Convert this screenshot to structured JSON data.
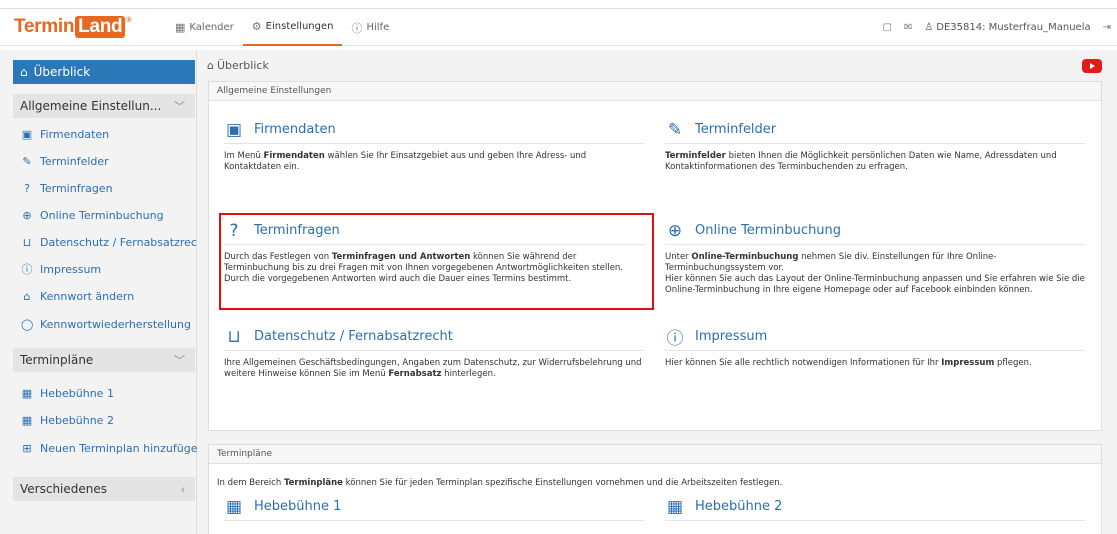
{
  "topbar": {
    "logo_a": "Termin",
    "logo_b": "Land",
    "logo_mark": "®",
    "nav": [
      {
        "label": "Kalender",
        "icon": "calendar-icon"
      },
      {
        "label": "Einstellungen",
        "icon": "gear-icon"
      },
      {
        "label": "Hilfe",
        "icon": "help-icon"
      }
    ],
    "user": "DE35814: Musterfrau_Manuela"
  },
  "sidebar": {
    "overview": "Überblick",
    "group1": "Allgemeine Einstellun...",
    "group1_items": [
      {
        "label": "Firmendaten",
        "icon": "id-card-icon"
      },
      {
        "label": "Terminfelder",
        "icon": "edit-icon"
      },
      {
        "label": "Terminfragen",
        "icon": "question-icon"
      },
      {
        "label": "Online Terminbuchung",
        "icon": "globe-icon"
      },
      {
        "label": "Datenschutz / Fernabsatzrecht",
        "icon": "cart-icon"
      },
      {
        "label": "Impressum",
        "icon": "info-icon"
      },
      {
        "label": "Kennwort ändern",
        "icon": "lock-icon"
      },
      {
        "label": "Kennwortwiederherstellung",
        "icon": "shield-icon"
      }
    ],
    "group2": "Terminpläne",
    "group2_items": [
      {
        "label": "Hebebühne 1",
        "icon": "calendar-grid-icon"
      },
      {
        "label": "Hebebühne 2",
        "icon": "calendar-grid-icon"
      },
      {
        "label": "Neuen Terminplan hinzufügen",
        "icon": "calendar-add-icon"
      }
    ],
    "group3": "Verschiedenes"
  },
  "main": {
    "breadcrumb": "Überblick",
    "panel1_title": "Allgemeine Einstellungen",
    "tiles": {
      "firmendaten": {
        "title": "Firmendaten",
        "d1": "Im Menü ",
        "b1": "Firmendaten",
        "d2": " wählen Sie Ihr Einsatzgebiet aus und geben Ihre Adress- und Kontaktdaten ein."
      },
      "terminfelder": {
        "title": "Terminfelder",
        "b1": "Terminfelder",
        "d1": " bieten Ihnen die Möglichkeit persönlichen Daten wie Name, Adressdaten und Kontaktinformationen des Terminbuchenden zu erfragen."
      },
      "terminfragen": {
        "title": "Terminfragen",
        "d1": "Durch das Festlegen von ",
        "b1": "Terminfragen und Antworten",
        "d2": " können Sie während der Terminbuchung bis zu drei Fragen mit von Ihnen vorgegebenen Antwortmöglichkeiten stellen. Durch die vorgegebenen Antworten wird auch die Dauer eines Termins bestimmt."
      },
      "online": {
        "title": "Online Terminbuchung",
        "d1": "Unter ",
        "b1": "Online-Terminbuchung",
        "d2": " nehmen Sie div. Einstellungen für Ihre Online-Terminbuchungssystem vor.",
        "d3": "Hier können Sie auch das Layout der Online-Terminbuchung anpassen und Sie erfahren wie Sie die Online-Terminbuchung in Ihre eigene Homepage oder auf Facebook einbinden können."
      },
      "datenschutz": {
        "title": "Datenschutz / Fernabsatzrecht",
        "d1": "Ihre Allgemeinen Geschäftsbedingungen, Angaben zum Datenschutz, zur Widerrufsbelehrung und weitere Hinweise können Sie im Menü ",
        "b1": "Fernabsatz",
        "d2": " hinterlegen."
      },
      "impressum": {
        "title": "Impressum",
        "d1": "Hier können Sie alle rechtlich notwendigen Informationen für Ihr ",
        "b1": "Impressum",
        "d2": " pflegen."
      }
    },
    "panel2_title": "Terminpläne",
    "panel2_d1": "In dem Bereich ",
    "panel2_b1": "Terminpläne",
    "panel2_d2": " können Sie für jeden Terminplan spezifische Einstellungen vornehmen und die Arbeitszeiten festlegen.",
    "plan1": "Hebebühne 1",
    "plan2": "Hebebühne 2"
  },
  "colors": {
    "accent": "#e8681f",
    "link": "#2b6fb0",
    "sidebar_active": "#2b78b8",
    "highlight": "#e01010"
  }
}
